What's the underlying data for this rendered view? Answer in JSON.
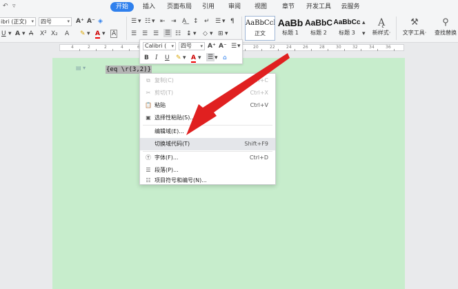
{
  "menu_tabs": [
    {
      "label": "开始",
      "active": true
    },
    {
      "label": "插入"
    },
    {
      "label": "页面布局"
    },
    {
      "label": "引用"
    },
    {
      "label": "审阅"
    },
    {
      "label": "视图"
    },
    {
      "label": "章节"
    },
    {
      "label": "开发工具"
    },
    {
      "label": "云服务"
    }
  ],
  "ribbon": {
    "font_name": "ibri (正文)",
    "font_size": "四号",
    "styles": [
      {
        "preview": "AaBbCcI",
        "label": "正文",
        "selected": true
      },
      {
        "preview": "AaBb",
        "label": "标题 1"
      },
      {
        "preview": "AaBbC",
        "label": "标题 2"
      },
      {
        "preview": "AaBbCc",
        "label": "标题 3"
      }
    ],
    "new_style": "新样式·",
    "text_tools": "文字工具·",
    "find_replace": "查找替换"
  },
  "ruler": {
    "numbers": [
      "4",
      "2",
      "2",
      "4",
      "6",
      "8",
      "10",
      "12",
      "14",
      "16",
      "18",
      "20",
      "22",
      "24",
      "26",
      "28",
      "30",
      "32",
      "34",
      "36"
    ]
  },
  "document": {
    "field_code": "{eq \\r(3,2)}"
  },
  "mini_toolbar": {
    "font_name": "Calibri (",
    "font_size": "四号"
  },
  "context_menu": [
    {
      "label": "复制(C)",
      "shortcut": "Ctrl+C",
      "disabled": true,
      "icon": "copy-icon"
    },
    {
      "label": "剪切(T)",
      "shortcut": "Ctrl+X",
      "disabled": true,
      "icon": "cut-icon"
    },
    {
      "label": "粘贴",
      "shortcut": "Ctrl+V",
      "icon": "paste-icon"
    },
    {
      "label": "选择性粘贴(S)...",
      "shortcut": "",
      "icon": "paste-special-icon"
    },
    {
      "label": "编辑域(E)...",
      "shortcut": "",
      "icon": ""
    },
    {
      "label": "切换域代码(T)",
      "shortcut": "Shift+F9",
      "hover": true,
      "icon": ""
    },
    {
      "label": "字体(F)...",
      "shortcut": "Ctrl+D",
      "icon": "font-icon"
    },
    {
      "label": "段落(P)...",
      "shortcut": "",
      "icon": "paragraph-icon"
    },
    {
      "label": "项目符号和编号(N)...",
      "shortcut": "",
      "icon": "list-icon"
    }
  ],
  "colors": {
    "accent": "#2f80ed",
    "page_bg": "#c7edcc",
    "arrow": "#e02020"
  }
}
